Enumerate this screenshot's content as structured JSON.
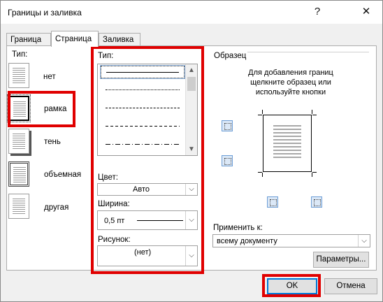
{
  "dialog": {
    "title": "Границы и заливка",
    "help": "?",
    "close": "✕"
  },
  "tabs": [
    "Граница",
    "Страница",
    "Заливка"
  ],
  "settings": {
    "label": "Тип:",
    "items": [
      "нет",
      "рамка",
      "тень",
      "объемная",
      "другая"
    ],
    "selected": "рамка"
  },
  "style": {
    "label": "Тип:",
    "line_styles": [
      "solid",
      "dotted",
      "dashed-small",
      "dashed",
      "dash-dot"
    ],
    "selected": "solid"
  },
  "color": {
    "label": "Цвет:",
    "value": "Авто"
  },
  "width": {
    "label": "Ширина:",
    "value": "0,5 пт"
  },
  "art": {
    "label": "Рисунок:",
    "value": "(нет)"
  },
  "preview": {
    "label": "Образец",
    "hint_line1": "Для добавления границ",
    "hint_line2": "щелкните образец или",
    "hint_line3": "используйте кнопки"
  },
  "apply_to": {
    "label": "Применить к:",
    "value": "всему документу"
  },
  "buttons": {
    "options": "Параметры...",
    "ok": "OK",
    "cancel": "Отмена"
  },
  "highlight_color": "#e00000"
}
